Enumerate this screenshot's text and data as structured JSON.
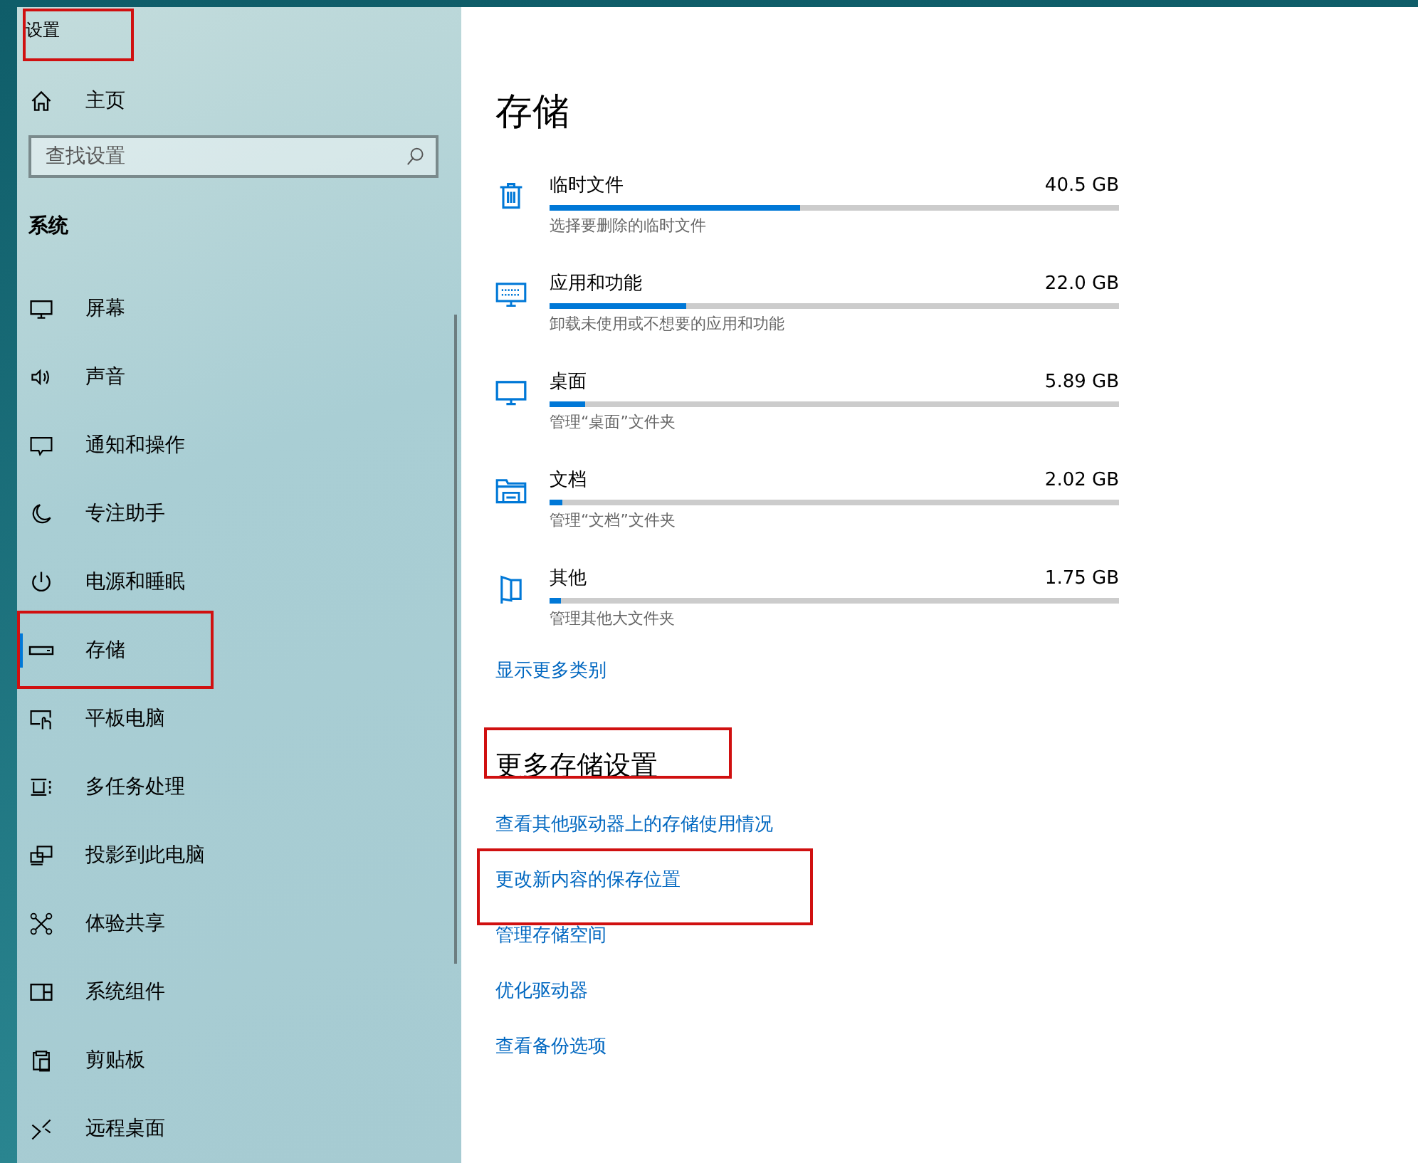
{
  "window": {
    "title": "设置",
    "annotated": true
  },
  "sidebar": {
    "home": "主页",
    "search": {
      "placeholder": "查找设置"
    },
    "section": "系统",
    "items": [
      {
        "label": "屏幕",
        "selected": false,
        "annotated": false
      },
      {
        "label": "声音",
        "selected": false,
        "annotated": false
      },
      {
        "label": "通知和操作",
        "selected": false,
        "annotated": false
      },
      {
        "label": "专注助手",
        "selected": false,
        "annotated": false
      },
      {
        "label": "电源和睡眠",
        "selected": false,
        "annotated": false
      },
      {
        "label": "存储",
        "selected": true,
        "annotated": true
      },
      {
        "label": "平板电脑",
        "selected": false,
        "annotated": false
      },
      {
        "label": "多任务处理",
        "selected": false,
        "annotated": false
      },
      {
        "label": "投影到此电脑",
        "selected": false,
        "annotated": false
      },
      {
        "label": "体验共享",
        "selected": false,
        "annotated": false
      },
      {
        "label": "系统组件",
        "selected": false,
        "annotated": false
      },
      {
        "label": "剪贴板",
        "selected": false,
        "annotated": false
      },
      {
        "label": "远程桌面",
        "selected": false,
        "annotated": false
      }
    ]
  },
  "main": {
    "heading": "存储",
    "categories": [
      {
        "name": "临时文件",
        "size": "40.5 GB",
        "level": 0.44,
        "description": "选择要删除的临时文件"
      },
      {
        "name": "应用和功能",
        "size": "22.0 GB",
        "level": 0.24,
        "description": "卸载未使用或不想要的应用和功能"
      },
      {
        "name": "桌面",
        "size": "5.89 GB",
        "level": 0.063,
        "description": "管理“桌面”文件夹"
      },
      {
        "name": "文档",
        "size": "2.02 GB",
        "level": 0.023,
        "description": "管理“文档”文件夹"
      },
      {
        "name": "其他",
        "size": "1.75 GB",
        "level": 0.02,
        "description": "管理其他大文件夹"
      }
    ],
    "show_more": "显示更多类别",
    "more_heading": {
      "text": "更多存储设置",
      "annotated": true
    },
    "links": [
      {
        "text": "查看其他驱动器上的存储使用情况",
        "annotated": false
      },
      {
        "text": "更改新内容的保存位置",
        "annotated": true
      },
      {
        "text": "管理存储空间",
        "annotated": false
      },
      {
        "text": "优化驱动器",
        "annotated": false
      },
      {
        "text": "查看备份选项",
        "annotated": false
      }
    ]
  }
}
